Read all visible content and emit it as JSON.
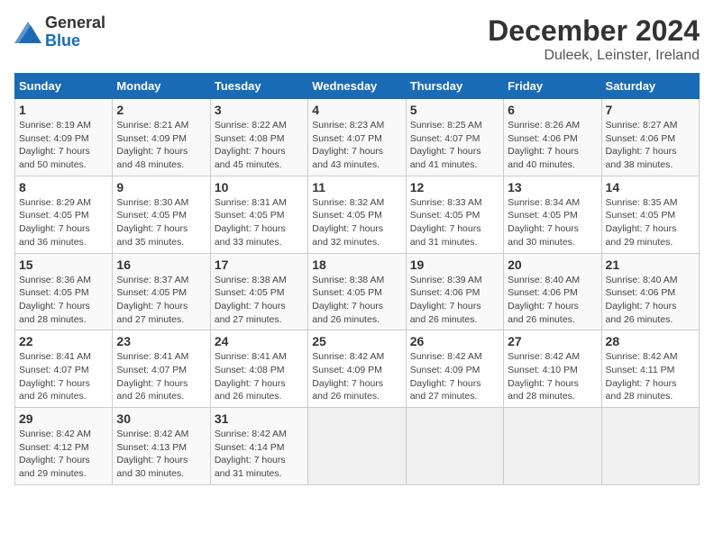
{
  "header": {
    "logo_general": "General",
    "logo_blue": "Blue",
    "title": "December 2024",
    "subtitle": "Duleek, Leinster, Ireland"
  },
  "calendar": {
    "days_of_week": [
      "Sunday",
      "Monday",
      "Tuesday",
      "Wednesday",
      "Thursday",
      "Friday",
      "Saturday"
    ],
    "weeks": [
      [
        {
          "day": "",
          "info": ""
        },
        {
          "day": "",
          "info": ""
        },
        {
          "day": "",
          "info": ""
        },
        {
          "day": "",
          "info": ""
        },
        {
          "day": "5",
          "info": "Sunrise: 8:25 AM\nSunset: 4:07 PM\nDaylight: 7 hours\nand 41 minutes."
        },
        {
          "day": "6",
          "info": "Sunrise: 8:26 AM\nSunset: 4:06 PM\nDaylight: 7 hours\nand 40 minutes."
        },
        {
          "day": "7",
          "info": "Sunrise: 8:27 AM\nSunset: 4:06 PM\nDaylight: 7 hours\nand 38 minutes."
        }
      ],
      [
        {
          "day": "1",
          "info": "Sunrise: 8:19 AM\nSunset: 4:09 PM\nDaylight: 7 hours\nand 50 minutes."
        },
        {
          "day": "2",
          "info": "Sunrise: 8:21 AM\nSunset: 4:09 PM\nDaylight: 7 hours\nand 48 minutes."
        },
        {
          "day": "3",
          "info": "Sunrise: 8:22 AM\nSunset: 4:08 PM\nDaylight: 7 hours\nand 45 minutes."
        },
        {
          "day": "4",
          "info": "Sunrise: 8:23 AM\nSunset: 4:07 PM\nDaylight: 7 hours\nand 43 minutes."
        },
        {
          "day": "5",
          "info": "Sunrise: 8:25 AM\nSunset: 4:07 PM\nDaylight: 7 hours\nand 41 minutes."
        },
        {
          "day": "6",
          "info": "Sunrise: 8:26 AM\nSunset: 4:06 PM\nDaylight: 7 hours\nand 40 minutes."
        },
        {
          "day": "7",
          "info": "Sunrise: 8:27 AM\nSunset: 4:06 PM\nDaylight: 7 hours\nand 38 minutes."
        }
      ],
      [
        {
          "day": "8",
          "info": "Sunrise: 8:29 AM\nSunset: 4:05 PM\nDaylight: 7 hours\nand 36 minutes."
        },
        {
          "day": "9",
          "info": "Sunrise: 8:30 AM\nSunset: 4:05 PM\nDaylight: 7 hours\nand 35 minutes."
        },
        {
          "day": "10",
          "info": "Sunrise: 8:31 AM\nSunset: 4:05 PM\nDaylight: 7 hours\nand 33 minutes."
        },
        {
          "day": "11",
          "info": "Sunrise: 8:32 AM\nSunset: 4:05 PM\nDaylight: 7 hours\nand 32 minutes."
        },
        {
          "day": "12",
          "info": "Sunrise: 8:33 AM\nSunset: 4:05 PM\nDaylight: 7 hours\nand 31 minutes."
        },
        {
          "day": "13",
          "info": "Sunrise: 8:34 AM\nSunset: 4:05 PM\nDaylight: 7 hours\nand 30 minutes."
        },
        {
          "day": "14",
          "info": "Sunrise: 8:35 AM\nSunset: 4:05 PM\nDaylight: 7 hours\nand 29 minutes."
        }
      ],
      [
        {
          "day": "15",
          "info": "Sunrise: 8:36 AM\nSunset: 4:05 PM\nDaylight: 7 hours\nand 28 minutes."
        },
        {
          "day": "16",
          "info": "Sunrise: 8:37 AM\nSunset: 4:05 PM\nDaylight: 7 hours\nand 27 minutes."
        },
        {
          "day": "17",
          "info": "Sunrise: 8:38 AM\nSunset: 4:05 PM\nDaylight: 7 hours\nand 27 minutes."
        },
        {
          "day": "18",
          "info": "Sunrise: 8:38 AM\nSunset: 4:05 PM\nDaylight: 7 hours\nand 26 minutes."
        },
        {
          "day": "19",
          "info": "Sunrise: 8:39 AM\nSunset: 4:06 PM\nDaylight: 7 hours\nand 26 minutes."
        },
        {
          "day": "20",
          "info": "Sunrise: 8:40 AM\nSunset: 4:06 PM\nDaylight: 7 hours\nand 26 minutes."
        },
        {
          "day": "21",
          "info": "Sunrise: 8:40 AM\nSunset: 4:06 PM\nDaylight: 7 hours\nand 26 minutes."
        }
      ],
      [
        {
          "day": "22",
          "info": "Sunrise: 8:41 AM\nSunset: 4:07 PM\nDaylight: 7 hours\nand 26 minutes."
        },
        {
          "day": "23",
          "info": "Sunrise: 8:41 AM\nSunset: 4:07 PM\nDaylight: 7 hours\nand 26 minutes."
        },
        {
          "day": "24",
          "info": "Sunrise: 8:41 AM\nSunset: 4:08 PM\nDaylight: 7 hours\nand 26 minutes."
        },
        {
          "day": "25",
          "info": "Sunrise: 8:42 AM\nSunset: 4:09 PM\nDaylight: 7 hours\nand 26 minutes."
        },
        {
          "day": "26",
          "info": "Sunrise: 8:42 AM\nSunset: 4:09 PM\nDaylight: 7 hours\nand 27 minutes."
        },
        {
          "day": "27",
          "info": "Sunrise: 8:42 AM\nSunset: 4:10 PM\nDaylight: 7 hours\nand 28 minutes."
        },
        {
          "day": "28",
          "info": "Sunrise: 8:42 AM\nSunset: 4:11 PM\nDaylight: 7 hours\nand 28 minutes."
        }
      ],
      [
        {
          "day": "29",
          "info": "Sunrise: 8:42 AM\nSunset: 4:12 PM\nDaylight: 7 hours\nand 29 minutes."
        },
        {
          "day": "30",
          "info": "Sunrise: 8:42 AM\nSunset: 4:13 PM\nDaylight: 7 hours\nand 30 minutes."
        },
        {
          "day": "31",
          "info": "Sunrise: 8:42 AM\nSunset: 4:14 PM\nDaylight: 7 hours\nand 31 minutes."
        },
        {
          "day": "",
          "info": ""
        },
        {
          "day": "",
          "info": ""
        },
        {
          "day": "",
          "info": ""
        },
        {
          "day": "",
          "info": ""
        }
      ]
    ]
  }
}
